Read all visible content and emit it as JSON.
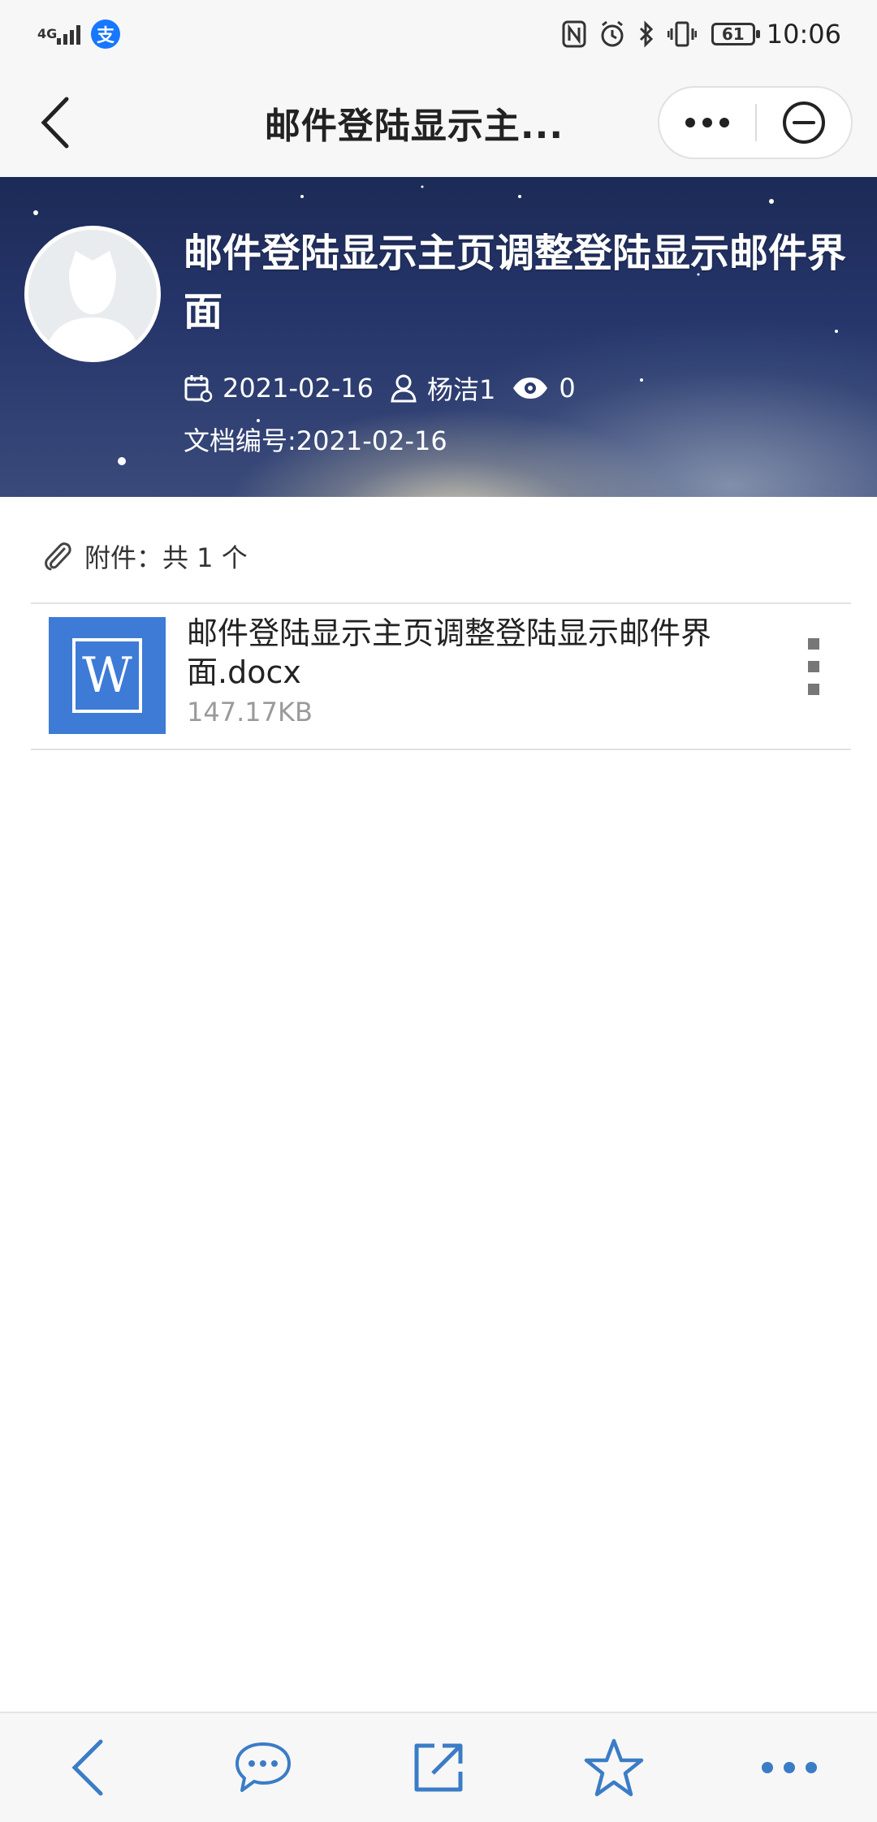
{
  "status_bar": {
    "network": "4G",
    "carrier_app_glyph": "支",
    "battery": "61",
    "time": "10:06",
    "icons": [
      "signal-icon",
      "alipay-icon",
      "nfc-icon",
      "alarm-icon",
      "bluetooth-icon",
      "vibrate-icon",
      "battery-icon"
    ]
  },
  "nav": {
    "title": "邮件登陆显示主...",
    "icons": [
      "back-arrow-icon",
      "more-dots-icon",
      "close-circle-icon"
    ]
  },
  "hero": {
    "title": "邮件登陆显示主页调整登陆显示邮件界面",
    "date": "2021-02-16",
    "author": "杨洁1",
    "views": "0",
    "doc_number": "文档编号:2021-02-16",
    "icons": [
      "calendar-icon",
      "user-icon",
      "eye-icon",
      "avatar-placeholder-icon"
    ]
  },
  "attachments": {
    "header": "附件：共 1 个",
    "icon": "paperclip-icon",
    "files": [
      {
        "name": "邮件登陆显示主页调整登陆显示邮件界面.docx",
        "size": "147.17KB",
        "type_glyph": "W",
        "icon": "word-file-icon"
      }
    ]
  },
  "toolbar": {
    "icons": [
      "back-icon",
      "comment-icon",
      "share-icon",
      "favorite-star-icon",
      "more-icon"
    ]
  },
  "colors": {
    "accent": "#3d7bd6",
    "toolbar_icon": "#3b7cc6",
    "bar_bg": "#f7f7f7",
    "muted_text": "#9a9a9a"
  }
}
